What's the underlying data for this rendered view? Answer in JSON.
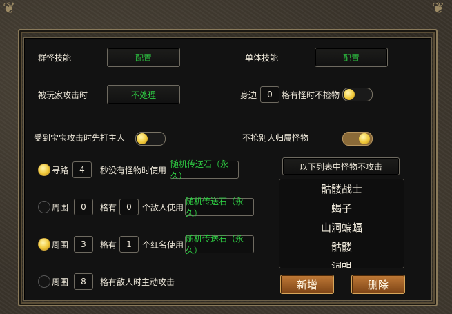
{
  "group_skill": {
    "label": "群怪技能",
    "button": "配置"
  },
  "single_skill": {
    "label": "单体技能",
    "button": "配置"
  },
  "attacked_by_player": {
    "label": "被玩家攻击时",
    "value": "不处理"
  },
  "nearby": {
    "prefix": "身边",
    "count": "0",
    "suffix": "格有怪时不捡物",
    "toggle_on": false
  },
  "pet_attack": {
    "label": "受到宝宝攻击时先打主人",
    "toggle_on": false
  },
  "no_loot_others": {
    "label": "不抢别人归属怪物",
    "toggle_on": true
  },
  "pathfind": {
    "label": "寻路",
    "value": "4",
    "text": "秒没有怪物时使用",
    "item": "随机传送石（永久）",
    "selected": true
  },
  "range_enemy": {
    "label": "周围",
    "range": "0",
    "mid": "格有",
    "count": "0",
    "text": "个敌人使用",
    "item": "随机传送石（永久）",
    "selected": false
  },
  "range_red": {
    "label": "周围",
    "range": "3",
    "mid": "格有",
    "count": "1",
    "text": "个红名使用",
    "item": "随机传送石（永久）",
    "selected": true
  },
  "range_attack": {
    "label": "周围",
    "range": "8",
    "text": "格有敌人时主动攻击",
    "selected": false
  },
  "monster_list": {
    "header": "以下列表中怪物不攻击",
    "items": [
      "骷髅战士",
      "蝎子",
      "山洞蝙蝠",
      "骷髅",
      "洞蛆"
    ],
    "add_button": "新增",
    "delete_button": "删除"
  },
  "colors": {
    "green_text": "#2ecc43",
    "accent": "#c07a37"
  }
}
